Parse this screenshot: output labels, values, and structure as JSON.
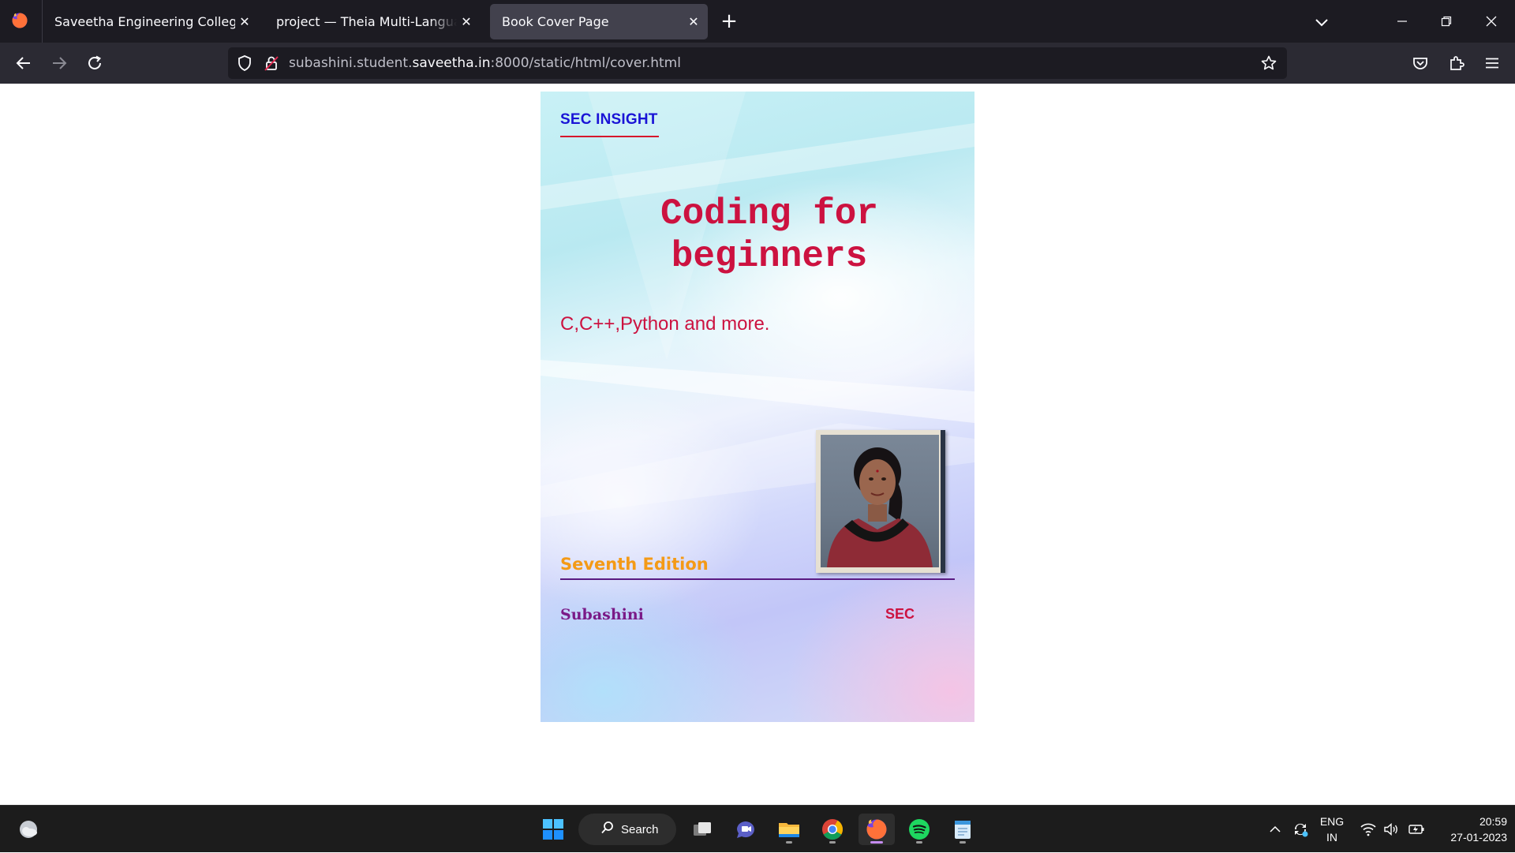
{
  "browser": {
    "tabs": [
      {
        "label": "Saveetha Engineering College",
        "active": false
      },
      {
        "label": "project — Theia Multi-Language Ex",
        "active": false
      },
      {
        "label": "Book Cover Page",
        "active": true
      }
    ],
    "url": {
      "prefix": "subashini.student.",
      "host": "saveetha.in",
      "suffix": ":8000/static/html/cover.html"
    },
    "colors": {
      "tabbar": "#1c1b22",
      "navbar": "#2b2a33",
      "active_tab": "#42414d"
    }
  },
  "cover": {
    "brand": "SEC INSIGHT",
    "title_line1": "Coding for",
    "title_line2": "beginners",
    "subtitle": "C,C++,Python and more.",
    "edition": "Seventh Edition",
    "author": "Subashini",
    "publisher": "SEC",
    "colors": {
      "brand": "#1a14d6",
      "title": "#cc1240",
      "edition": "#f49a16",
      "author": "#7a1a87",
      "divider": "#5a1a82"
    }
  },
  "taskbar": {
    "search_label": "Search",
    "language_line1": "ENG",
    "language_line2": "IN",
    "time": "20:59",
    "date": "27-01-2023",
    "pinned": [
      "file-explorer-icon",
      "chrome-icon",
      "firefox-icon",
      "spotify-icon",
      "notepad-icon"
    ]
  }
}
